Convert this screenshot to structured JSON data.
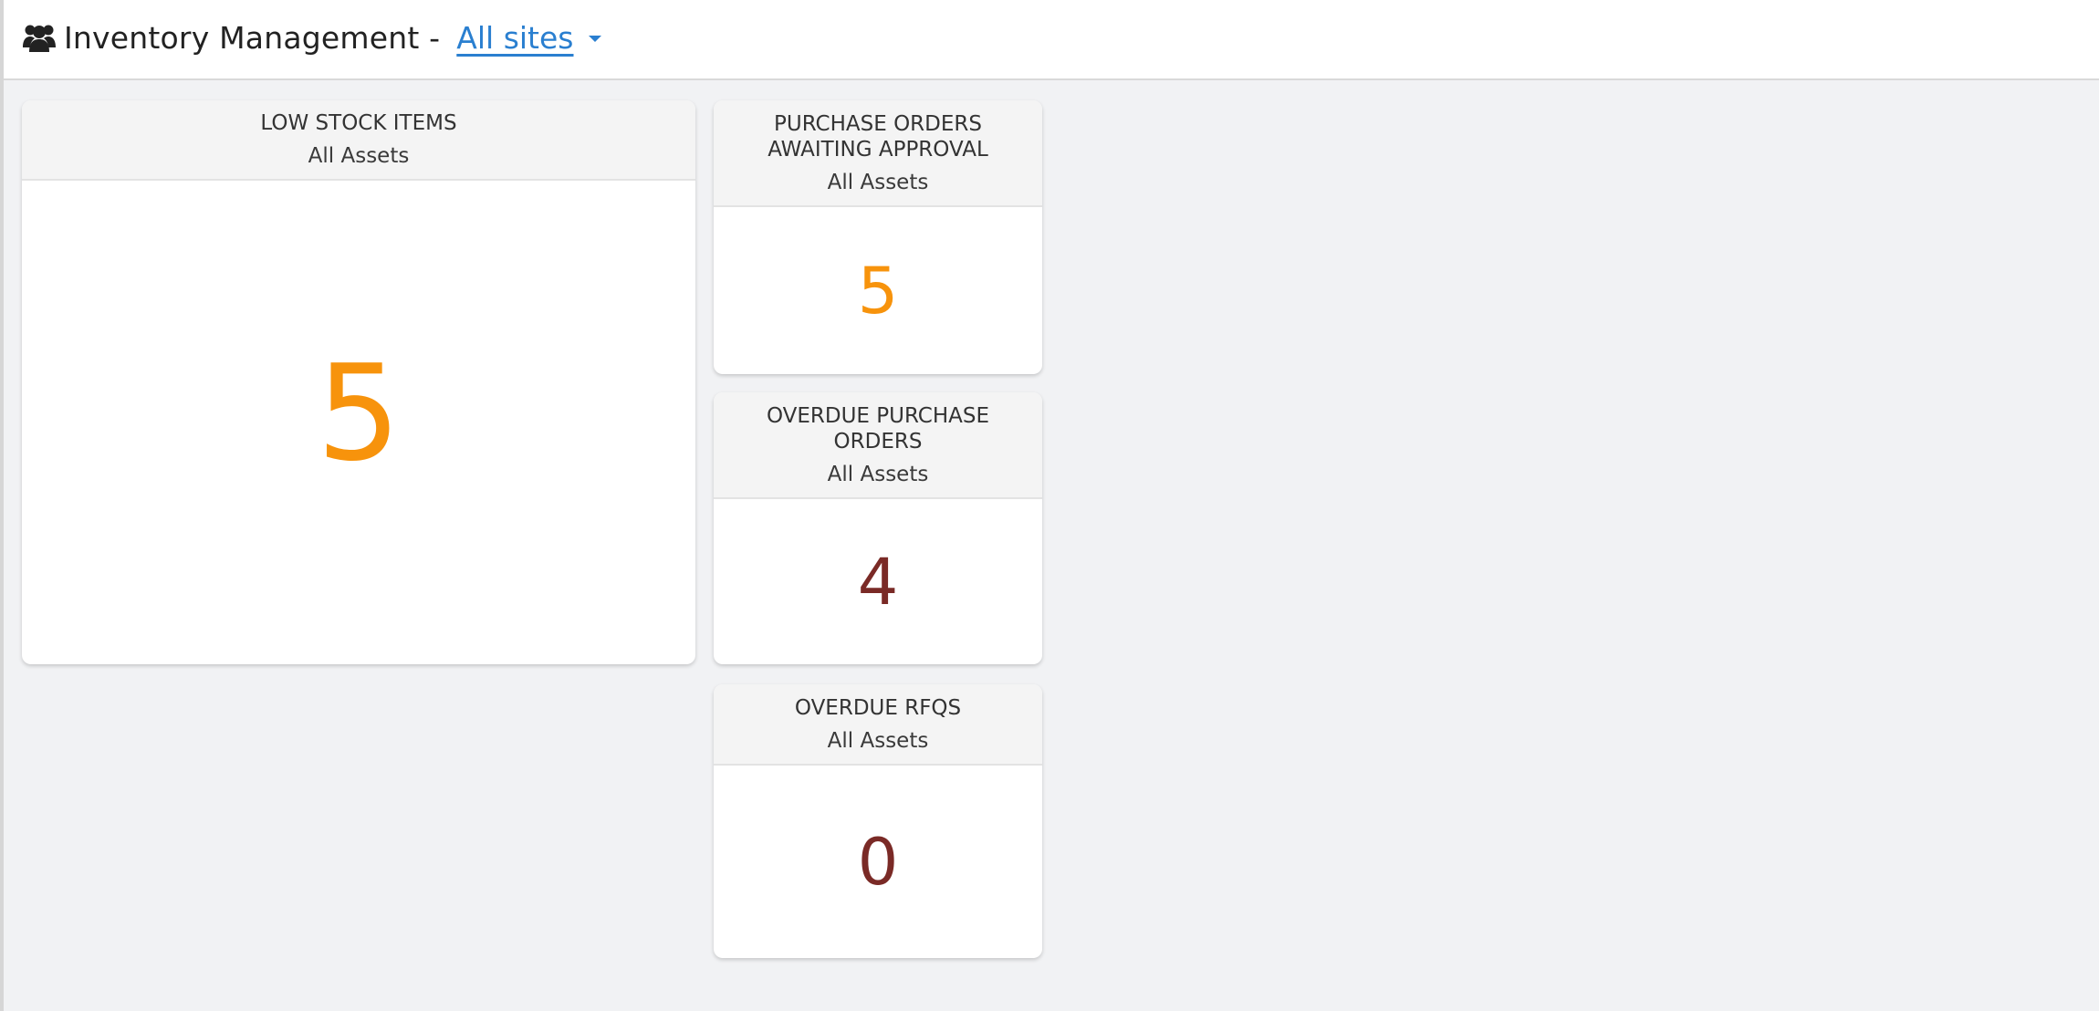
{
  "header": {
    "title": "Inventory Management -",
    "site_selector": "All sites",
    "icon": "users-icon",
    "link_color": "#2a7fd0"
  },
  "cards": [
    {
      "title": "LOW STOCK ITEMS",
      "subtitle": "All Assets",
      "value": "5",
      "value_color": "#f7930c"
    },
    {
      "title": "PURCHASE ORDERS AWAITING APPROVAL",
      "subtitle": "All Assets",
      "value": "5",
      "value_color": "#f7930c"
    },
    {
      "title": "OVERDUE PURCHASE ORDERS",
      "subtitle": "All Assets",
      "value": "4",
      "value_color": "#7a2a26"
    },
    {
      "title": "OVERDUE RFQS",
      "subtitle": "All Assets",
      "value": "0",
      "value_color": "#7a2a26"
    }
  ]
}
